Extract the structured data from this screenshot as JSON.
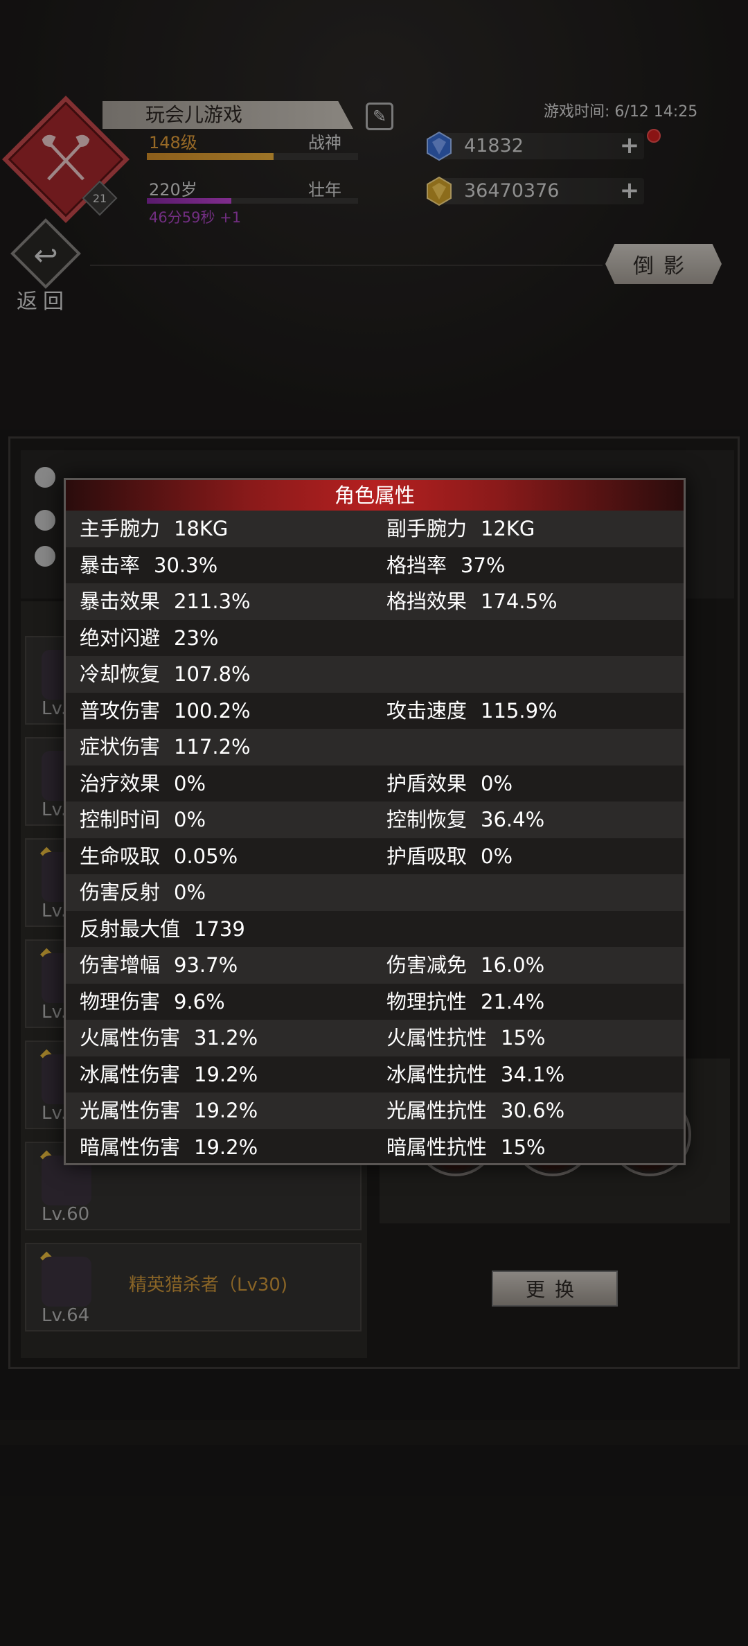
{
  "header": {
    "player_name": "玩会儿游戏",
    "level": "148级",
    "rank": "战神",
    "level_progress": 0.6,
    "age": "220岁",
    "age_stage": "壮年",
    "age_progress": 0.4,
    "age_timer": "46分59秒 +1",
    "emblem_badge": "21",
    "game_time": "游戏时间: 6/12 14:25",
    "currency": {
      "gems": "41832",
      "gold": "36470376"
    },
    "back_label": "返回",
    "reflect_label": "倒影"
  },
  "list": {
    "cards": [
      {
        "lv": "Lv."
      },
      {
        "lv": "Lv."
      },
      {
        "lv": "Lv."
      },
      {
        "lv": "Lv."
      },
      {
        "lv": "Lv."
      },
      {
        "lv": "Lv.60"
      },
      {
        "lv": "Lv.64",
        "name": "精英猎杀者（Lv30)"
      }
    ]
  },
  "swap_label": "更换",
  "modal": {
    "title": "角色属性",
    "rows": [
      {
        "l_name": "主手腕力",
        "l_val": "18KG",
        "r_name": "副手腕力",
        "r_val": "12KG"
      },
      {
        "l_name": "暴击率",
        "l_val": "30.3%",
        "r_name": "格挡率",
        "r_val": "37%"
      },
      {
        "l_name": "暴击效果",
        "l_val": "211.3%",
        "r_name": "格挡效果",
        "r_val": "174.5%"
      },
      {
        "l_name": "绝对闪避",
        "l_val": "23%",
        "r_name": "",
        "r_val": ""
      },
      {
        "l_name": "冷却恢复",
        "l_val": "107.8%",
        "r_name": "",
        "r_val": ""
      },
      {
        "l_name": "普攻伤害",
        "l_val": "100.2%",
        "r_name": "攻击速度",
        "r_val": "115.9%"
      },
      {
        "l_name": "症状伤害",
        "l_val": "117.2%",
        "r_name": "",
        "r_val": ""
      },
      {
        "l_name": "治疗效果",
        "l_val": "0%",
        "r_name": "护盾效果",
        "r_val": "0%"
      },
      {
        "l_name": "控制时间",
        "l_val": "0%",
        "r_name": "控制恢复",
        "r_val": "36.4%"
      },
      {
        "l_name": "生命吸取",
        "l_val": "0.05%",
        "r_name": "护盾吸取",
        "r_val": "0%"
      },
      {
        "l_name": "伤害反射",
        "l_val": "0%",
        "r_name": "",
        "r_val": ""
      },
      {
        "l_name": "反射最大值",
        "l_val": "1739",
        "r_name": "",
        "r_val": ""
      },
      {
        "l_name": "伤害增幅",
        "l_val": "93.7%",
        "r_name": "伤害减免",
        "r_val": "16.0%"
      },
      {
        "l_name": "物理伤害",
        "l_val": "9.6%",
        "r_name": "物理抗性",
        "r_val": "21.4%"
      },
      {
        "l_name": "火属性伤害",
        "l_val": "31.2%",
        "r_name": "火属性抗性",
        "r_val": "15%"
      },
      {
        "l_name": "冰属性伤害",
        "l_val": "19.2%",
        "r_name": "冰属性抗性",
        "r_val": "34.1%"
      },
      {
        "l_name": "光属性伤害",
        "l_val": "19.2%",
        "r_name": "光属性抗性",
        "r_val": "30.6%"
      },
      {
        "l_name": "暗属性伤害",
        "l_val": "19.2%",
        "r_name": "暗属性抗性",
        "r_val": "15%"
      }
    ]
  },
  "colors": {
    "accent_red": "#b52020",
    "level_orange": "#e8a23b",
    "age_purple": "#b048c8"
  }
}
